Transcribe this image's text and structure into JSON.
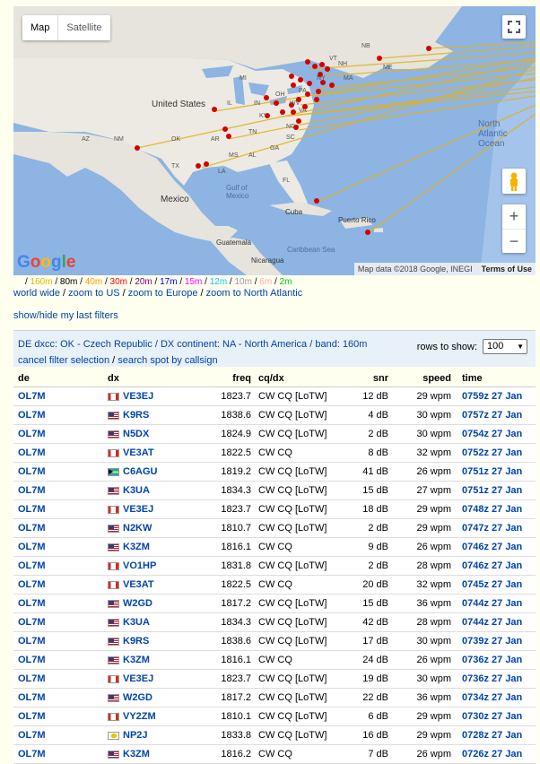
{
  "map": {
    "tabs": [
      "Map",
      "Satellite"
    ],
    "labels": {
      "united_states": "United States",
      "mexico": "Mexico",
      "gulf": "Gulf of\nMexico",
      "north_atlantic": "North\nAtlantic\nOcean",
      "cuba": "Cuba",
      "puerto_rico": "Puerto Rico",
      "caribbean": "Caribbean Sea",
      "guatemala": "Guatemala",
      "nicaragua": "Nicaragua"
    },
    "state_labels": [
      "NB",
      "ME",
      "VT",
      "NH",
      "MA",
      "NY",
      "PA",
      "MI",
      "OH",
      "IN",
      "IL",
      "WV",
      "VA",
      "KY",
      "NC",
      "TN",
      "SC",
      "GA",
      "AL",
      "MS",
      "AR",
      "OK",
      "TX",
      "LA",
      "FL",
      "NM",
      "AZ"
    ],
    "google_logo": "Google",
    "attribution": "Map data ©2018 Google, INEGI",
    "terms": "Terms of Use",
    "zoom_in": "+",
    "zoom_out": "−"
  },
  "bands": [
    {
      "label": "160m",
      "color": "#e8b800"
    },
    {
      "label": "80m",
      "color": "#000000"
    },
    {
      "label": "40m",
      "color": "#ff9900"
    },
    {
      "label": "30m",
      "color": "#ff0000"
    },
    {
      "label": "20m",
      "color": "#800080"
    },
    {
      "label": "17m",
      "color": "#0000ff"
    },
    {
      "label": "15m",
      "color": "#ff00ff"
    },
    {
      "label": "12m",
      "color": "#00ccff"
    },
    {
      "label": "10m",
      "color": "#999999"
    },
    {
      "label": "6m",
      "color": "#ffaaaa"
    },
    {
      "label": "2m",
      "color": "#00cc00"
    }
  ],
  "zoom_links": [
    "world wide",
    "zoom to US",
    "zoom to Europe",
    "zoom to North Atlantic"
  ],
  "show_hide": "show/hide my last filters",
  "filter": {
    "line": "DE dxcc: OK - Czech Republic / DX continent: NA - North America / band: 160m",
    "cancel": "cancel filter selection",
    "search": "search spot by callsign",
    "rows_label": "rows to show:",
    "rows_value": "100"
  },
  "table": {
    "headers": [
      "de",
      "dx",
      "freq",
      "cq/dx",
      "snr",
      "speed",
      "time"
    ],
    "rows": [
      {
        "de": "OL7M",
        "flag": "ca",
        "dx": "VE3EJ",
        "freq": "1823.7",
        "cq": "CW CQ [LoTW]",
        "snr": "12 dB",
        "speed": "29 wpm",
        "time": "0759z 27 Jan"
      },
      {
        "de": "OL7M",
        "flag": "us",
        "dx": "K9RS",
        "freq": "1838.6",
        "cq": "CW CQ [LoTW]",
        "snr": "4 dB",
        "speed": "30 wpm",
        "time": "0757z 27 Jan"
      },
      {
        "de": "OL7M",
        "flag": "us",
        "dx": "N5DX",
        "freq": "1824.9",
        "cq": "CW CQ [LoTW]",
        "snr": "2 dB",
        "speed": "30 wpm",
        "time": "0754z 27 Jan"
      },
      {
        "de": "OL7M",
        "flag": "ca",
        "dx": "VE3AT",
        "freq": "1822.5",
        "cq": "CW CQ",
        "snr": "8 dB",
        "speed": "32 wpm",
        "time": "0752z 27 Jan"
      },
      {
        "de": "OL7M",
        "flag": "bs",
        "dx": "C6AGU",
        "freq": "1819.2",
        "cq": "CW CQ [LoTW]",
        "snr": "41 dB",
        "speed": "26 wpm",
        "time": "0751z 27 Jan"
      },
      {
        "de": "OL7M",
        "flag": "us",
        "dx": "K3UA",
        "freq": "1834.3",
        "cq": "CW CQ [LoTW]",
        "snr": "15 dB",
        "speed": "27 wpm",
        "time": "0751z 27 Jan"
      },
      {
        "de": "OL7M",
        "flag": "ca",
        "dx": "VE3EJ",
        "freq": "1823.7",
        "cq": "CW CQ [LoTW]",
        "snr": "18 dB",
        "speed": "29 wpm",
        "time": "0748z 27 Jan"
      },
      {
        "de": "OL7M",
        "flag": "us",
        "dx": "N2KW",
        "freq": "1810.7",
        "cq": "CW CQ [LoTW]",
        "snr": "2 dB",
        "speed": "29 wpm",
        "time": "0747z 27 Jan"
      },
      {
        "de": "OL7M",
        "flag": "us",
        "dx": "K3ZM",
        "freq": "1816.1",
        "cq": "CW CQ",
        "snr": "9 dB",
        "speed": "26 wpm",
        "time": "0746z 27 Jan"
      },
      {
        "de": "OL7M",
        "flag": "ca",
        "dx": "VO1HP",
        "freq": "1831.8",
        "cq": "CW CQ [LoTW]",
        "snr": "2 dB",
        "speed": "28 wpm",
        "time": "0746z 27 Jan"
      },
      {
        "de": "OL7M",
        "flag": "ca",
        "dx": "VE3AT",
        "freq": "1822.5",
        "cq": "CW CQ",
        "snr": "20 dB",
        "speed": "32 wpm",
        "time": "0745z 27 Jan"
      },
      {
        "de": "OL7M",
        "flag": "us",
        "dx": "W2GD",
        "freq": "1817.2",
        "cq": "CW CQ [LoTW]",
        "snr": "15 dB",
        "speed": "36 wpm",
        "time": "0744z 27 Jan"
      },
      {
        "de": "OL7M",
        "flag": "us",
        "dx": "K3UA",
        "freq": "1834.3",
        "cq": "CW CQ [LoTW]",
        "snr": "42 dB",
        "speed": "28 wpm",
        "time": "0744z 27 Jan"
      },
      {
        "de": "OL7M",
        "flag": "us",
        "dx": "K9RS",
        "freq": "1838.6",
        "cq": "CW CQ [LoTW]",
        "snr": "17 dB",
        "speed": "30 wpm",
        "time": "0739z 27 Jan"
      },
      {
        "de": "OL7M",
        "flag": "us",
        "dx": "K3ZM",
        "freq": "1816.1",
        "cq": "CW CQ",
        "snr": "24 dB",
        "speed": "26 wpm",
        "time": "0736z 27 Jan"
      },
      {
        "de": "OL7M",
        "flag": "ca",
        "dx": "VE3EJ",
        "freq": "1823.7",
        "cq": "CW CQ [LoTW]",
        "snr": "19 dB",
        "speed": "30 wpm",
        "time": "0736z 27 Jan"
      },
      {
        "de": "OL7M",
        "flag": "us",
        "dx": "W2GD",
        "freq": "1817.2",
        "cq": "CW CQ [LoTW]",
        "snr": "22 dB",
        "speed": "36 wpm",
        "time": "0734z 27 Jan"
      },
      {
        "de": "OL7M",
        "flag": "ca",
        "dx": "VY2ZM",
        "freq": "1810.1",
        "cq": "CW CQ [LoTW]",
        "snr": "6 dB",
        "speed": "29 wpm",
        "time": "0730z 27 Jan"
      },
      {
        "de": "OL7M",
        "flag": "vi",
        "dx": "NP2J",
        "freq": "1833.8",
        "cq": "CW CQ [LoTW]",
        "snr": "16 dB",
        "speed": "29 wpm",
        "time": "0728z 27 Jan"
      },
      {
        "de": "OL7M",
        "flag": "us",
        "dx": "K3ZM",
        "freq": "1816.2",
        "cq": "CW CQ",
        "snr": "7 dB",
        "speed": "26 wpm",
        "time": "0726z 27 Jan"
      }
    ]
  }
}
